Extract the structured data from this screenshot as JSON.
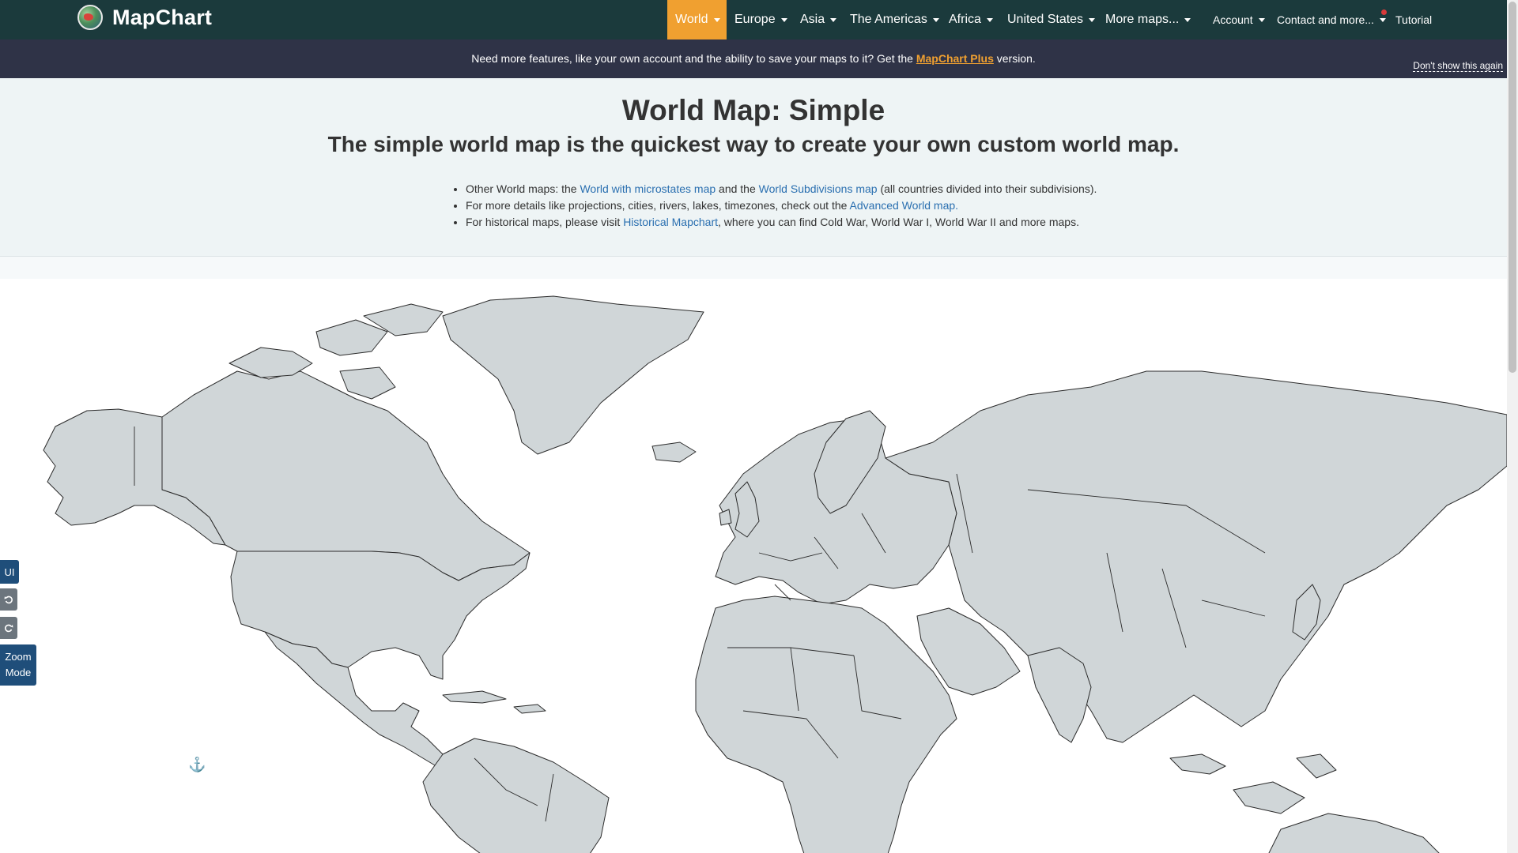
{
  "navbar": {
    "brand": "MapChart",
    "items": [
      {
        "label": "World",
        "active": true
      },
      {
        "label": "Europe"
      },
      {
        "label": "Asia"
      },
      {
        "label": "The Americas"
      },
      {
        "label": "Africa"
      },
      {
        "label": "United States"
      },
      {
        "label": "More maps..."
      }
    ],
    "account_label": "Account",
    "contact_label": "Contact and more...",
    "tutorial_label": "Tutorial",
    "active_color": "#f0a030",
    "background_color": "#1b3a3c"
  },
  "banner": {
    "text_before": "Need more features, like your own account and the ability to save your maps to it? Get the",
    "link_text": "MapChart Plus",
    "text_after": "version.",
    "dismiss_label": "Don't show this again"
  },
  "intro": {
    "title": "World Map: Simple",
    "subtitle": "The simple world map is the quickest way to create your own custom world map.",
    "items": [
      {
        "pre": "Other World maps: the",
        "link1": "World with microstates map",
        "mid": "and the",
        "link2": "World Subdivisions map",
        "post": "(all countries divided into their subdivisions)."
      },
      {
        "pre": "For more details like projections, cities, rivers, lakes, timezones, check out the",
        "link1": "Advanced World map.",
        "post": ""
      },
      {
        "pre": "For historical maps, please visit",
        "link1": "Historical Mapchart",
        "post": ", where you can find Cold War, World War I, World War II and more maps."
      }
    ]
  },
  "tools": {
    "ui_label": "UI",
    "undo_icon": "undo-icon",
    "redo_icon": "redo-icon",
    "zoom_label_line1": "Zoom",
    "zoom_label_line2": "Mode"
  },
  "map": {
    "land_color": "#d0d6d8",
    "border_color": "#2b2b2b"
  }
}
